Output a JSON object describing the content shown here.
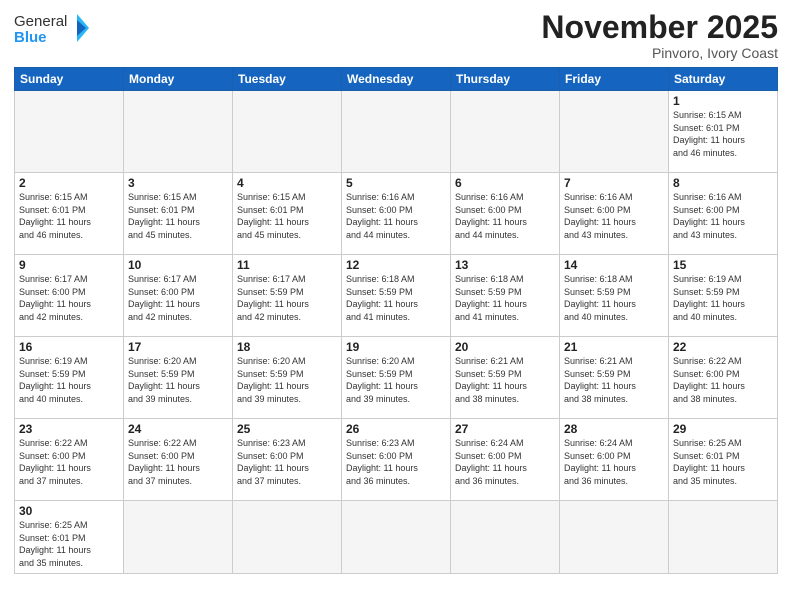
{
  "header": {
    "logo_general": "General",
    "logo_blue": "Blue",
    "month_title": "November 2025",
    "location": "Pinvoro, Ivory Coast"
  },
  "days_of_week": [
    "Sunday",
    "Monday",
    "Tuesday",
    "Wednesday",
    "Thursday",
    "Friday",
    "Saturday"
  ],
  "weeks": [
    [
      {
        "day": "",
        "info": ""
      },
      {
        "day": "",
        "info": ""
      },
      {
        "day": "",
        "info": ""
      },
      {
        "day": "",
        "info": ""
      },
      {
        "day": "",
        "info": ""
      },
      {
        "day": "",
        "info": ""
      },
      {
        "day": "1",
        "info": "Sunrise: 6:15 AM\nSunset: 6:01 PM\nDaylight: 11 hours\nand 46 minutes."
      }
    ],
    [
      {
        "day": "2",
        "info": "Sunrise: 6:15 AM\nSunset: 6:01 PM\nDaylight: 11 hours\nand 46 minutes."
      },
      {
        "day": "3",
        "info": "Sunrise: 6:15 AM\nSunset: 6:01 PM\nDaylight: 11 hours\nand 45 minutes."
      },
      {
        "day": "4",
        "info": "Sunrise: 6:15 AM\nSunset: 6:01 PM\nDaylight: 11 hours\nand 45 minutes."
      },
      {
        "day": "5",
        "info": "Sunrise: 6:16 AM\nSunset: 6:00 PM\nDaylight: 11 hours\nand 44 minutes."
      },
      {
        "day": "6",
        "info": "Sunrise: 6:16 AM\nSunset: 6:00 PM\nDaylight: 11 hours\nand 44 minutes."
      },
      {
        "day": "7",
        "info": "Sunrise: 6:16 AM\nSunset: 6:00 PM\nDaylight: 11 hours\nand 43 minutes."
      },
      {
        "day": "8",
        "info": "Sunrise: 6:16 AM\nSunset: 6:00 PM\nDaylight: 11 hours\nand 43 minutes."
      }
    ],
    [
      {
        "day": "9",
        "info": "Sunrise: 6:17 AM\nSunset: 6:00 PM\nDaylight: 11 hours\nand 42 minutes."
      },
      {
        "day": "10",
        "info": "Sunrise: 6:17 AM\nSunset: 6:00 PM\nDaylight: 11 hours\nand 42 minutes."
      },
      {
        "day": "11",
        "info": "Sunrise: 6:17 AM\nSunset: 5:59 PM\nDaylight: 11 hours\nand 42 minutes."
      },
      {
        "day": "12",
        "info": "Sunrise: 6:18 AM\nSunset: 5:59 PM\nDaylight: 11 hours\nand 41 minutes."
      },
      {
        "day": "13",
        "info": "Sunrise: 6:18 AM\nSunset: 5:59 PM\nDaylight: 11 hours\nand 41 minutes."
      },
      {
        "day": "14",
        "info": "Sunrise: 6:18 AM\nSunset: 5:59 PM\nDaylight: 11 hours\nand 40 minutes."
      },
      {
        "day": "15",
        "info": "Sunrise: 6:19 AM\nSunset: 5:59 PM\nDaylight: 11 hours\nand 40 minutes."
      }
    ],
    [
      {
        "day": "16",
        "info": "Sunrise: 6:19 AM\nSunset: 5:59 PM\nDaylight: 11 hours\nand 40 minutes."
      },
      {
        "day": "17",
        "info": "Sunrise: 6:20 AM\nSunset: 5:59 PM\nDaylight: 11 hours\nand 39 minutes."
      },
      {
        "day": "18",
        "info": "Sunrise: 6:20 AM\nSunset: 5:59 PM\nDaylight: 11 hours\nand 39 minutes."
      },
      {
        "day": "19",
        "info": "Sunrise: 6:20 AM\nSunset: 5:59 PM\nDaylight: 11 hours\nand 39 minutes."
      },
      {
        "day": "20",
        "info": "Sunrise: 6:21 AM\nSunset: 5:59 PM\nDaylight: 11 hours\nand 38 minutes."
      },
      {
        "day": "21",
        "info": "Sunrise: 6:21 AM\nSunset: 5:59 PM\nDaylight: 11 hours\nand 38 minutes."
      },
      {
        "day": "22",
        "info": "Sunrise: 6:22 AM\nSunset: 6:00 PM\nDaylight: 11 hours\nand 38 minutes."
      }
    ],
    [
      {
        "day": "23",
        "info": "Sunrise: 6:22 AM\nSunset: 6:00 PM\nDaylight: 11 hours\nand 37 minutes."
      },
      {
        "day": "24",
        "info": "Sunrise: 6:22 AM\nSunset: 6:00 PM\nDaylight: 11 hours\nand 37 minutes."
      },
      {
        "day": "25",
        "info": "Sunrise: 6:23 AM\nSunset: 6:00 PM\nDaylight: 11 hours\nand 37 minutes."
      },
      {
        "day": "26",
        "info": "Sunrise: 6:23 AM\nSunset: 6:00 PM\nDaylight: 11 hours\nand 36 minutes."
      },
      {
        "day": "27",
        "info": "Sunrise: 6:24 AM\nSunset: 6:00 PM\nDaylight: 11 hours\nand 36 minutes."
      },
      {
        "day": "28",
        "info": "Sunrise: 6:24 AM\nSunset: 6:00 PM\nDaylight: 11 hours\nand 36 minutes."
      },
      {
        "day": "29",
        "info": "Sunrise: 6:25 AM\nSunset: 6:01 PM\nDaylight: 11 hours\nand 35 minutes."
      }
    ],
    [
      {
        "day": "30",
        "info": "Sunrise: 6:25 AM\nSunset: 6:01 PM\nDaylight: 11 hours\nand 35 minutes."
      },
      {
        "day": "",
        "info": ""
      },
      {
        "day": "",
        "info": ""
      },
      {
        "day": "",
        "info": ""
      },
      {
        "day": "",
        "info": ""
      },
      {
        "day": "",
        "info": ""
      },
      {
        "day": "",
        "info": ""
      }
    ]
  ]
}
